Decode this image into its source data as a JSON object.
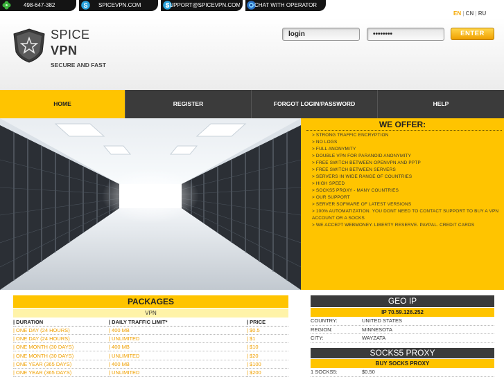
{
  "topbar": {
    "phone": "498-647-382",
    "site": "SPICEVPN.COM",
    "email": "SUPPORT@SPICEVPN.COM",
    "chat": "CHAT WITH OPERATOR"
  },
  "lang": {
    "en": "EN",
    "cn": "CN",
    "ru": "RU",
    "sep": "|"
  },
  "brand": {
    "line1": "SPICE",
    "line2": "VPN",
    "tagline": "SECURE AND FAST"
  },
  "login": {
    "login_value": "login",
    "password_value": "••••••••",
    "enter_label": "ENTER"
  },
  "nav": [
    "HOME",
    "REGISTER",
    "FORGOT LOGIN/PASSWORD",
    "HELP"
  ],
  "offer": {
    "title": "WE OFFER:",
    "items": [
      "> STRONG TRAFFIC ENCRYPTION",
      "> NO LOGS",
      "> FULL ANONYMITY",
      "> DOUBLE VPN FOR PARANOID ANONYMITY",
      "> FREE SWITCH BETWEEN OPENVPN AND PPTP",
      "> FREE SWITCH BETWEEN SERVERS",
      "> SERVERS IN WIDE RANGE OF COUNTRIES",
      "> HIGH SPEED",
      "> SOCKS5 PROXY - MANY COUNTRIES",
      "> OUR SUPPORT",
      "> SERVER SOFWARE OF LATEST VERSIONS",
      "> 100% AUTOMATIZATION. YOU DONT NEED TO CONTACT SUPPORT TO BUY A VPN ACCOUNT OR A SOCKS",
      "> WE ACCEPT WEBMONEY. LIBERTY RESERVE. PAYPAL. CREDIT CARDS"
    ]
  },
  "packages": {
    "title": "PACKAGES",
    "subtitle": "VPN",
    "headers": [
      "| DURATION",
      "| DAILY TRAFFIC LIMIT*",
      "| PRICE"
    ],
    "rows": [
      [
        "| ONE DAY (24 HOURS)",
        "| 400 MB",
        "| $0.5"
      ],
      [
        "| ONE DAY (24 HOURS)",
        "| UNLIMITED",
        "| $1"
      ],
      [
        "| ONE MONTH (30 DAYS)",
        "| 400 MB",
        "| $10"
      ],
      [
        "| ONE MONTH (30 DAYS)",
        "| UNLIMITED",
        "| $20"
      ],
      [
        "| ONE YEAR (365 DAYS)",
        "| 400 MB",
        "| $100"
      ],
      [
        "| ONE YEAR (365 DAYS)",
        "| UNLIMITED",
        "| $200"
      ]
    ]
  },
  "geo": {
    "title": "GEO IP",
    "ip": "IP 70.59.126.252",
    "rows": [
      {
        "key": "COUNTRY:",
        "value": "UNITED STATES"
      },
      {
        "key": "REGION:",
        "value": "MINNESOTA"
      },
      {
        "key": "CITY:",
        "value": "WAYZATA"
      }
    ]
  },
  "proxy": {
    "title": "SOCKS5 PROXY",
    "buy_label": "BUY SOCKS PROXY",
    "rows": [
      {
        "key": "1 SOCKS5:",
        "value": "$0.50"
      }
    ]
  },
  "colors": {
    "accent": "#ffc400",
    "dark": "#3b3b3b",
    "link": "#f0a000"
  },
  "icons": {
    "phone": "clover-icon",
    "site": "skype-icon",
    "email": "skype-icon",
    "chat": "chat-icon"
  }
}
